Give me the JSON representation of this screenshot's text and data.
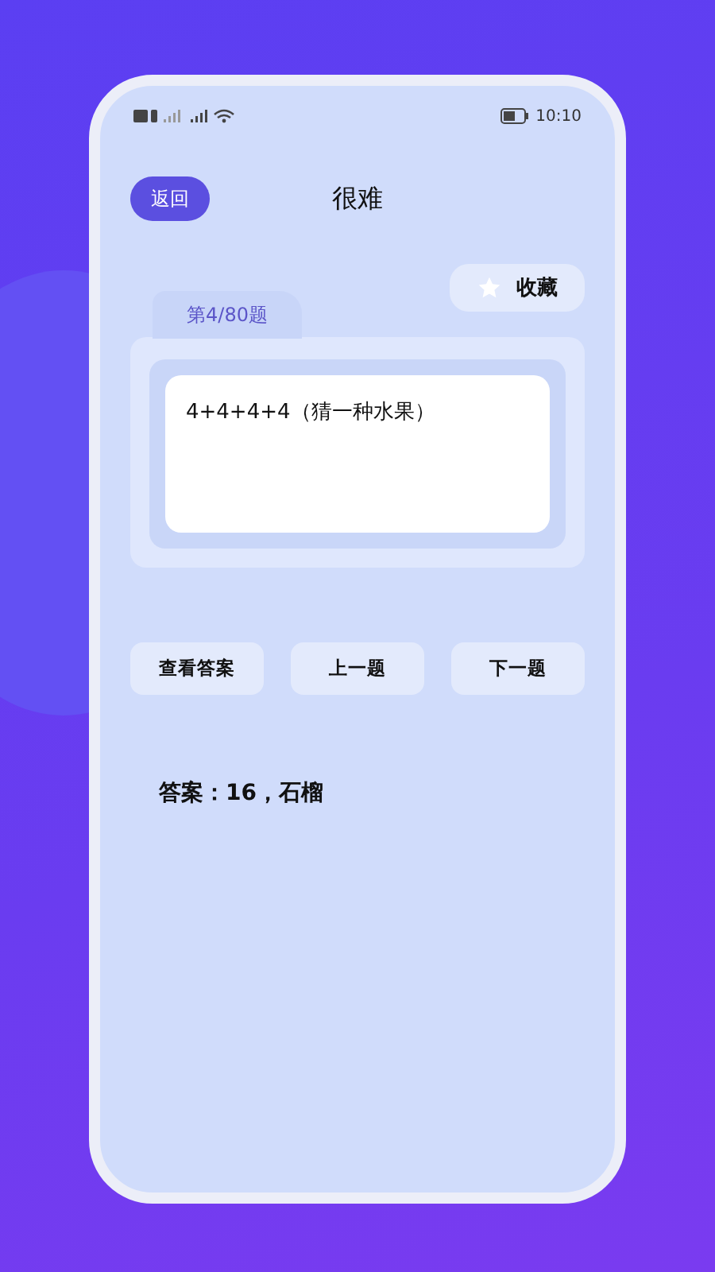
{
  "status_bar": {
    "time": "10:10"
  },
  "header": {
    "back_button": "返回",
    "title": "很难"
  },
  "favorite_button": {
    "label": "收藏",
    "favorited": false
  },
  "question": {
    "counter": "第4/80题",
    "text": "4+4+4+4（猜一种水果）"
  },
  "buttons": [
    {
      "label": "查看答案"
    },
    {
      "label": "上一题"
    },
    {
      "label": "下一题"
    }
  ],
  "answer": "答案：16，石榴"
}
